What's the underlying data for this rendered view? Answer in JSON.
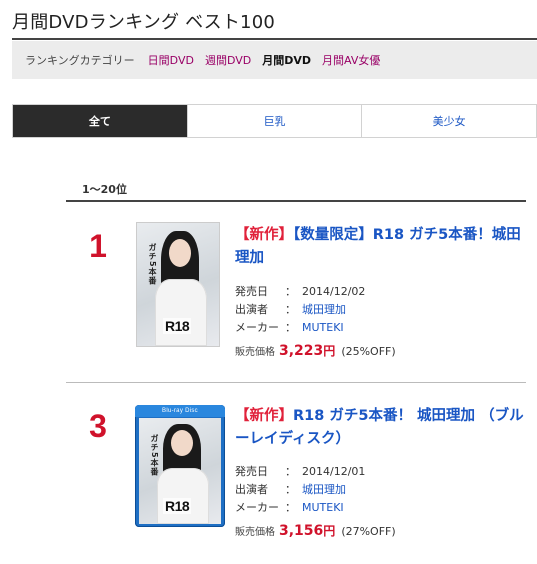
{
  "page": {
    "title": "月間DVDランキング ベスト100"
  },
  "categories": {
    "label": "ランキングカテゴリー",
    "items": [
      {
        "label": "日間DVD",
        "active": false
      },
      {
        "label": "週間DVD",
        "active": false
      },
      {
        "label": "月間DVD",
        "active": true
      },
      {
        "label": "月間AV女優",
        "active": false
      }
    ]
  },
  "tabs": [
    {
      "label": "全て",
      "active": true
    },
    {
      "label": "巨乳",
      "active": false
    },
    {
      "label": "美少女",
      "active": false
    }
  ],
  "range_label": "1〜20位",
  "items": [
    {
      "rank": "1",
      "new_tag": "【新作】",
      "title": "【数量限定】R18 ガチ5本番！城田理加",
      "release_label": "発売日",
      "release": "2014/12/02",
      "actor_label": "出演者",
      "actor": "城田理加",
      "maker_label": "メーカー",
      "maker": "MUTEKI",
      "price_label": "販売価格",
      "price": "3,223",
      "yen": "円",
      "discount": "(25%OFF)",
      "cover": {
        "vtext": "ガチ5本番",
        "badge": "R18"
      }
    },
    {
      "rank": "3",
      "new_tag": "【新作】",
      "title": "R18 ガチ5本番！ 城田理加 （ブルーレイディスク）",
      "release_label": "発売日",
      "release": "2014/12/01",
      "actor_label": "出演者",
      "actor": "城田理加",
      "maker_label": "メーカー",
      "maker": "MUTEKI",
      "price_label": "販売価格",
      "price": "3,156",
      "yen": "円",
      "discount": "(27%OFF)",
      "cover": {
        "vtext": "ガチ5本番",
        "badge": "R18",
        "format_logo": "Blu-ray Disc"
      }
    }
  ],
  "separator": "："
}
